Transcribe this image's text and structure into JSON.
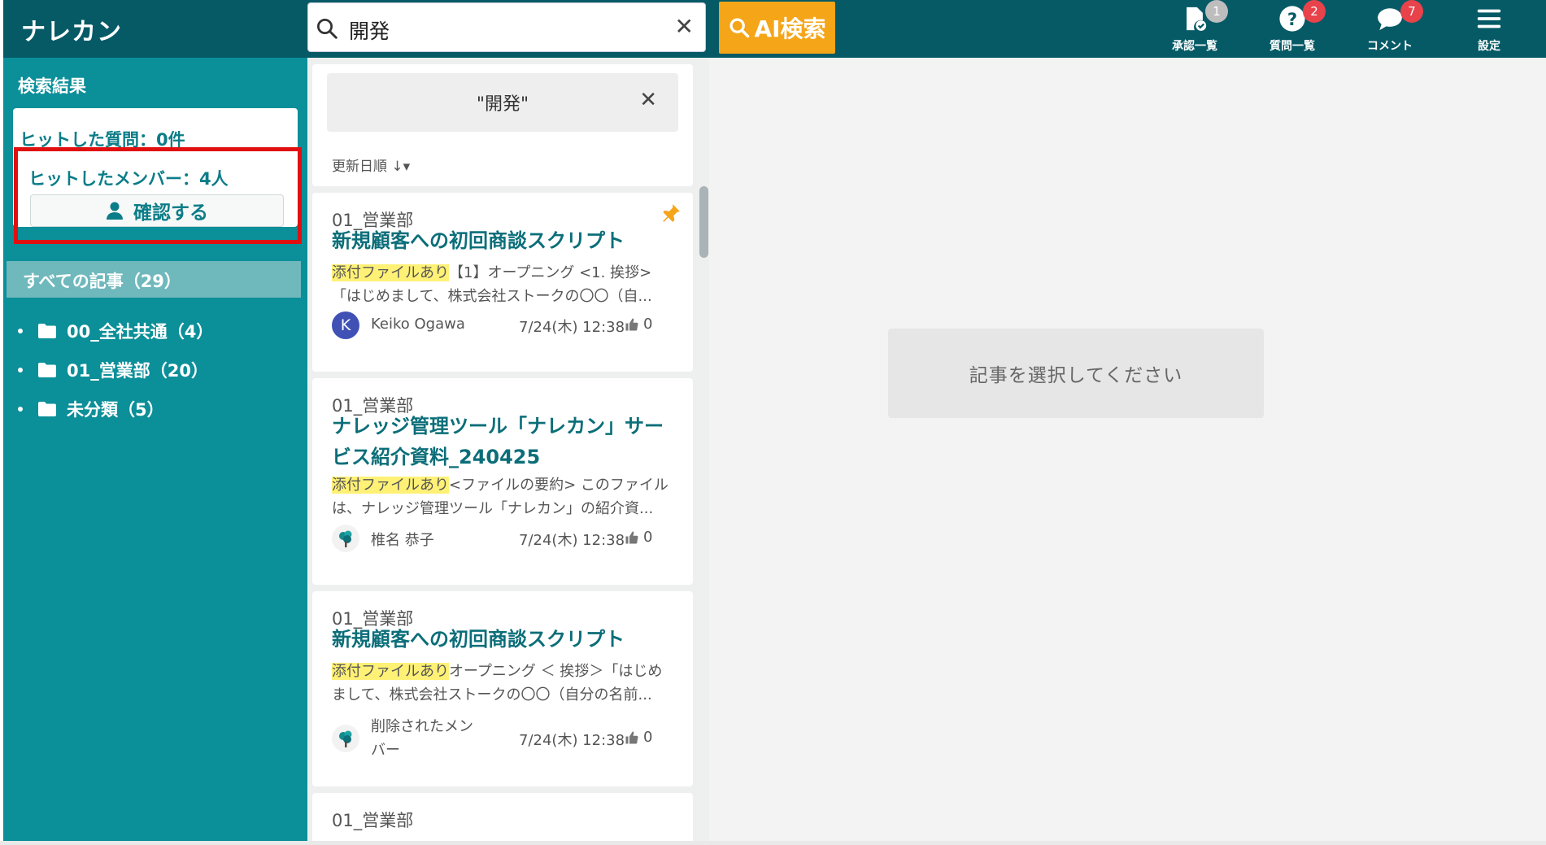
{
  "header": {
    "logo": "ナレカン",
    "search_value": "開発",
    "ai_search_label": "AI検索",
    "nav": [
      {
        "label": "承認一覧",
        "badge": "1",
        "icon": "file-check-icon"
      },
      {
        "label": "質問一覧",
        "badge": "2",
        "icon": "question-circle-icon"
      },
      {
        "label": "コメント",
        "badge": "7",
        "icon": "comment-icon"
      },
      {
        "label": "設定",
        "icon": "hamburger-menu-icon"
      }
    ],
    "colors": {
      "bar": "#055a66",
      "ai_button": "#f5a518",
      "badge_red": "#e8424a",
      "badge_gray": "#bdbdbd"
    }
  },
  "sidebar": {
    "title": "検索結果",
    "hit_questions": "ヒットした質問：0件",
    "hit_members": "ヒットしたメンバー：4人",
    "confirm_label": "確認する",
    "all_articles": "すべての記事（29）",
    "folders": [
      {
        "label": "00_全社共通（4）"
      },
      {
        "label": "01_営業部（20）"
      },
      {
        "label": "未分類（5）"
      }
    ],
    "color": "#0b8f99"
  },
  "list": {
    "filter_chip": "\"開発\"",
    "sort_label": "更新日順",
    "cards": [
      {
        "category": "01_営業部",
        "title": "新規顧客への初回商談スクリプト",
        "badge": "添付ファイルあり",
        "snippet_1": "【1】オープニング <1. 挨拶>",
        "snippet_2": "「はじめまして、株式会社ストークの〇〇（自...",
        "avatar_letter": "K",
        "author": "Keiko Ogawa",
        "date": "7/24(木) 12:38",
        "likes": "0",
        "pinned": true
      },
      {
        "category": "01_営業部",
        "title": "ナレッジ管理ツール「ナレカン」サービス紹介資料_240425",
        "badge": "添付ファイルあり",
        "snippet_1": "<ファイルの要約> このファイル",
        "snippet_2": "は、ナレッジ管理ツール「ナレカン」の紹介資...",
        "author": "椎名 恭子",
        "date": "7/24(木) 12:38",
        "likes": "0"
      },
      {
        "category": "01_営業部",
        "title": "新規顧客への初回商談スクリプト",
        "badge": "添付ファイルあり",
        "snippet_1": "オープニング ＜ 挨拶＞「はじめ",
        "snippet_2": "まして、株式会社ストークの〇〇（自分の名前...",
        "author_1": "削除されたメン",
        "author_2": "バー",
        "date": "7/24(木) 12:38",
        "likes": "0"
      },
      {
        "category": "01_営業部"
      }
    ]
  },
  "detail": {
    "placeholder": "記事を選択してください"
  }
}
